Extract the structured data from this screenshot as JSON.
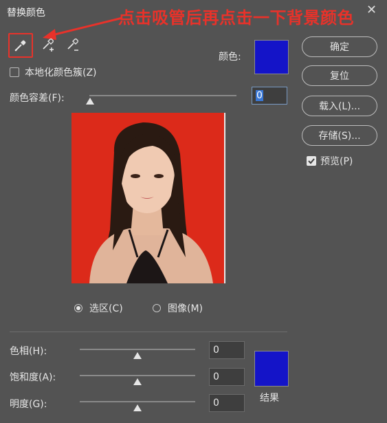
{
  "window": {
    "title": "替换颜色",
    "close_glyph": "✕"
  },
  "annotation": {
    "text": "点击吸管后再点击一下背景颜色"
  },
  "tools": {
    "eyedropper": "eyedropper-icon",
    "eyedropper_add": "eyedropper-plus-icon",
    "eyedropper_subtract": "eyedropper-minus-icon"
  },
  "color": {
    "label": "颜色:",
    "swatch": "#1414c8"
  },
  "localized_clusters": {
    "label": "本地化颜色簇(Z)",
    "checked": false
  },
  "fuzziness": {
    "label": "颜色容差(F):",
    "value": "0"
  },
  "preview_mode": {
    "selection_label": "选区(C)",
    "image_label": "图像(M)",
    "selected": "selection"
  },
  "buttons": {
    "ok": "确定",
    "reset": "复位",
    "load": "载入(L)...",
    "save": "存储(S)..."
  },
  "preview": {
    "label": "预览(P)",
    "checked": true
  },
  "replacement": {
    "hue_label": "色相(H):",
    "hue_value": "0",
    "saturation_label": "饱和度(A):",
    "saturation_value": "0",
    "lightness_label": "明度(G):",
    "lightness_value": "0",
    "result_label": "结果",
    "result_swatch": "#1414c8"
  },
  "colors": {
    "annotation_red": "#e8322a",
    "photo_background": "#dc2a1a"
  }
}
